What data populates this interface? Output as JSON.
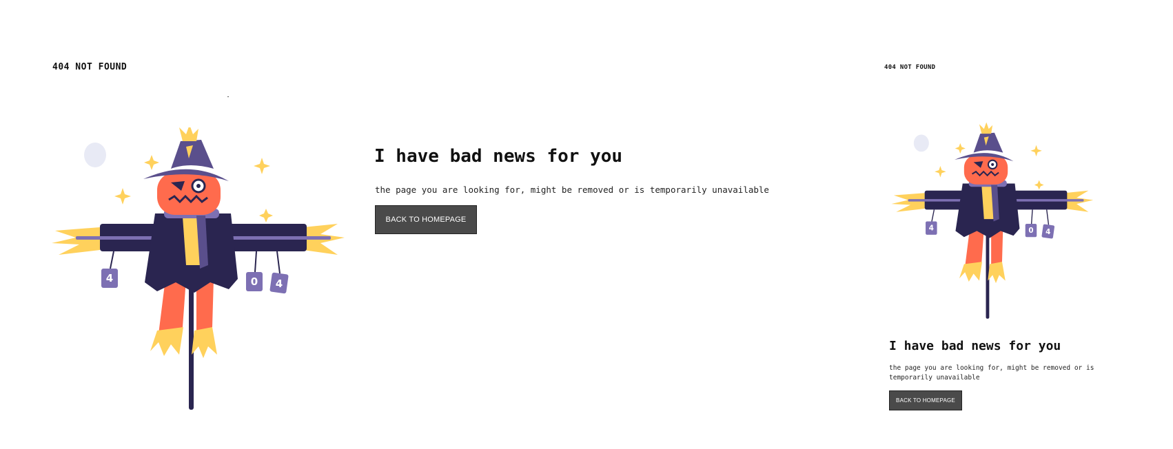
{
  "brand": "404 NOT FOUND",
  "heading": "I have bad news for you",
  "subtitle": "the page you are looking for, might be removed or is temporarily unavailable",
  "button_label": "BACK TO HOMEPAGE",
  "illustration": {
    "subject": "scarecrow-404",
    "can_digits": [
      "4",
      "0",
      "4"
    ]
  },
  "colors": {
    "background": "#ffffff",
    "text": "#111111",
    "button_bg": "#4a4a4a",
    "button_text": "#ffffff",
    "hat": "#5a4f8c",
    "coat": "#2a2550",
    "pumpkin": "#ff6b4d",
    "straw": "#ffd15c",
    "can": "#7d70b3",
    "moon": "#e8eaf5"
  }
}
